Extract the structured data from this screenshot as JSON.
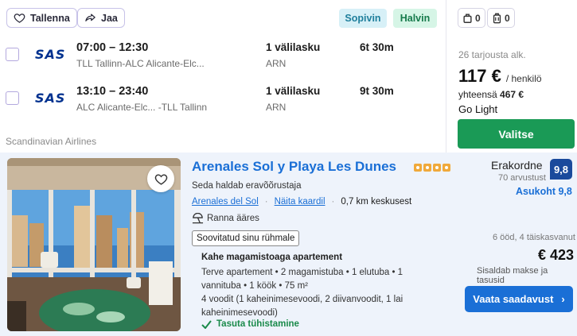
{
  "flight": {
    "save_label": "Tallenna",
    "share_label": "Jaa",
    "tag_fit": "Sopivin",
    "tag_cheap": "Halvin",
    "segments": [
      {
        "airline_logo": "SAS",
        "time": "07:00 – 12:30",
        "route": "TLL Tallinn-ALC Alicante-Elc...",
        "stops": "1 välilasku",
        "via": "ARN",
        "duration": "6t 30m"
      },
      {
        "airline_logo": "SAS",
        "time": "13:10 – 23:40",
        "route": "ALC Alicante-Elc... -TLL Tallinn",
        "stops": "1 välilasku",
        "via": "ARN",
        "duration": "9t 30m"
      }
    ],
    "airline_name": "Scandinavian Airlines",
    "cabin_bag_count": "0",
    "checked_bag_count": "0",
    "offers": "26 tarjousta alk.",
    "price": "117 €",
    "per_person": "/ henkilö",
    "total_label": "yhteensä",
    "total_value": "467 €",
    "fare_class": "Go Light",
    "select_label": "Valitse",
    "accent_color": "#1a9a56"
  },
  "hotel": {
    "title": "Arenales Sol y Playa Les Dunes",
    "star_count": 4,
    "manager": "Seda haldab eravõõrustaja",
    "area_link": "Arenales del Sol",
    "map_link": "Näita kaardil",
    "distance": "0,7 km keskusest",
    "beach": "Ranna ääres",
    "group_tag": "Soovitatud sinu rühmale",
    "room_name": "Kahe magamistoaga apartement",
    "room_desc": "Terve apartement • 2 magamistuba • 1 elutuba • 1 vannituba • 1 köök • 75 m²",
    "beds": "4 voodit (1 kaheinimesevoodi, 2 diivanvoodit, 1 lai kaheinimesevoodi)",
    "cancel": "Tasuta tühistamine",
    "rating_word": "Erakordne",
    "reviews": "70 arvustust",
    "score": "9,8",
    "location_score": "Asukoht 9,8",
    "nights": "6 ööd, 4 täiskasvanut",
    "price": "€ 423",
    "taxes": "Sisaldab makse ja tasusid",
    "availability_label": "Vaata saadavust",
    "link_color": "#1a6fd6"
  }
}
